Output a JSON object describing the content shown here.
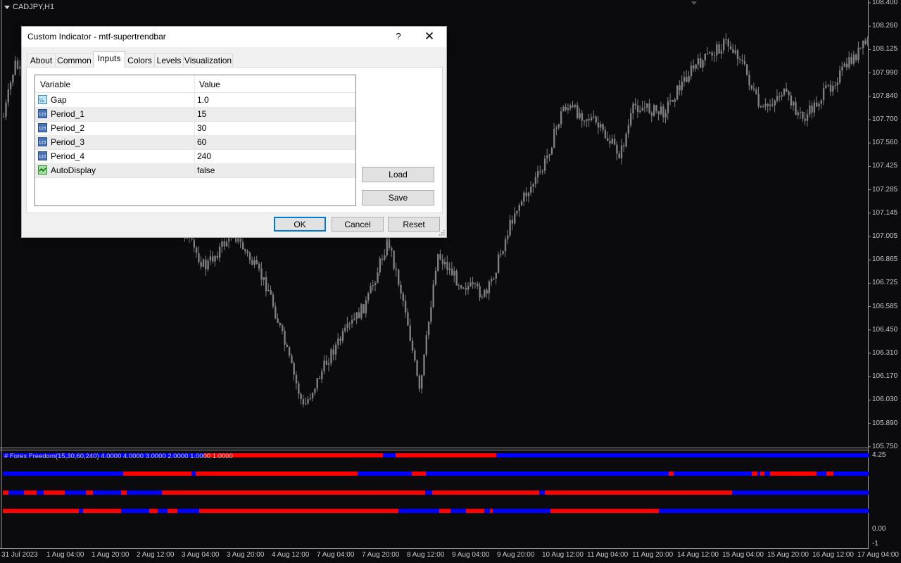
{
  "chart": {
    "symbol": "CADJPY,H1",
    "price_scale": [
      "108.400",
      "108.260",
      "108.125",
      "107.990",
      "107.840",
      "107.700",
      "107.560",
      "107.425",
      "107.285",
      "107.145",
      "107.005",
      "106.865",
      "106.725",
      "106.585",
      "106.450",
      "106.310",
      "106.170",
      "106.030",
      "105.890",
      "105.750"
    ],
    "time_axis": [
      "31 Jul 2023",
      "1 Aug 04:00",
      "1 Aug 20:00",
      "2 Aug 12:00",
      "3 Aug 04:00",
      "3 Aug 20:00",
      "4 Aug 12:00",
      "7 Aug 04:00",
      "7 Aug 20:00",
      "8 Aug 12:00",
      "9 Aug 04:00",
      "9 Aug 20:00",
      "10 Aug 12:00",
      "11 Aug 04:00",
      "11 Aug 20:00",
      "14 Aug 12:00",
      "15 Aug 04:00",
      "15 Aug 20:00",
      "16 Aug 12:00",
      "17 Aug 04:00"
    ],
    "colors": {
      "background": "#0b0b0e",
      "candle": "#7f7f7f",
      "grid_line": "#9a9a9a",
      "bull_bar": "#0000ff",
      "bear_bar": "#ff0000"
    }
  },
  "indicator": {
    "label": "# Forex Freedom(15,30,60,240) 4.0000 4.0000 3.0000 2.0000 1.0000 1.0000",
    "scale": [
      "4.25",
      "0.00",
      "-1"
    ]
  },
  "dialog": {
    "title": "Custom Indicator - mtf-supertrendbar",
    "help": "?",
    "close": "✕",
    "tabs": [
      "About",
      "Common",
      "Inputs",
      "Colors",
      "Levels",
      "Visualization"
    ],
    "active_tab": "Inputs",
    "grid": {
      "headers": {
        "variable": "Variable",
        "value": "Value"
      },
      "rows": [
        {
          "icon": "fraction-icon",
          "variable": "Gap",
          "value": "1.0"
        },
        {
          "icon": "integer-icon",
          "variable": "Period_1",
          "value": "15"
        },
        {
          "icon": "integer-icon",
          "variable": "Period_2",
          "value": "30"
        },
        {
          "icon": "integer-icon",
          "variable": "Period_3",
          "value": "60"
        },
        {
          "icon": "integer-icon",
          "variable": "Period_4",
          "value": "240"
        },
        {
          "icon": "boolean-icon",
          "variable": "AutoDisplay",
          "value": "false"
        }
      ]
    },
    "buttons": {
      "load": "Load",
      "save": "Save",
      "ok": "OK",
      "cancel": "Cancel",
      "reset": "Reset"
    }
  }
}
